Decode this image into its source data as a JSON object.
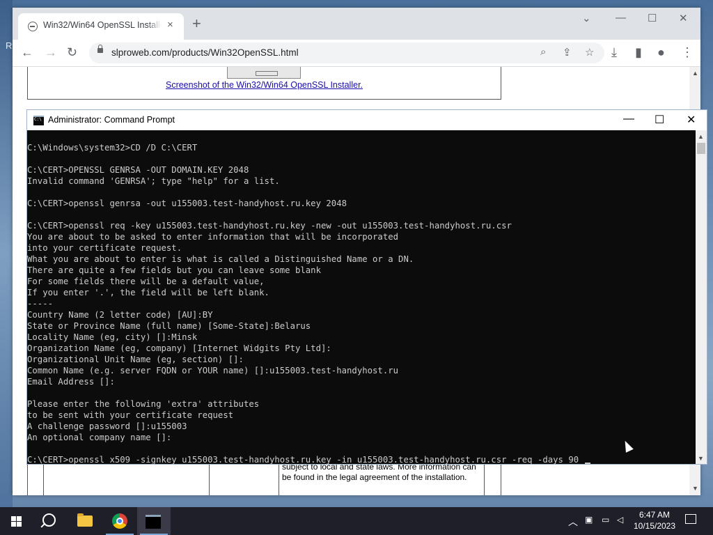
{
  "browser": {
    "tab_title": "Win32/Win64 OpenSSL Installer f",
    "tab_close": "×",
    "new_tab": "+",
    "url": "slproweb.com/products/Win32OpenSSL.html",
    "window_controls": {
      "dropdown": "⌄",
      "minimize": "—",
      "maximize": "☐",
      "close": "✕"
    },
    "nav": {
      "back": "←",
      "forward": "→",
      "reload": "↻"
    },
    "omnibox_icons": {
      "search": "⌕",
      "share": "⇪",
      "bookmark": "☆"
    },
    "toolbar_icons": {
      "download": "⤓",
      "sidepanel": "▮",
      "profile": "●",
      "menu": "⋮"
    },
    "page": {
      "screenshot_link": "Screenshot of the Win32/Win64 OpenSSL Installer.",
      "legal_text": "subject to local and state laws. More information can be found in the legal agreement of the installation."
    }
  },
  "cmd": {
    "title": "Administrator: Command Prompt",
    "controls": {
      "minimize": "—",
      "maximize": "☐",
      "close": "✕"
    },
    "lines": [
      "C:\\Windows\\system32>CD /D C:\\CERT",
      "",
      "C:\\CERT>OPENSSL GENRSA -OUT DOMAIN.KEY 2048",
      "Invalid command 'GENRSA'; type \"help\" for a list.",
      "",
      "C:\\CERT>openssl genrsa -out u155003.test-handyhost.ru.key 2048",
      "",
      "C:\\CERT>openssl req -key u155003.test-handyhost.ru.key -new -out u155003.test-handyhost.ru.csr",
      "You are about to be asked to enter information that will be incorporated",
      "into your certificate request.",
      "What you are about to enter is what is called a Distinguished Name or a DN.",
      "There are quite a few fields but you can leave some blank",
      "For some fields there will be a default value,",
      "If you enter '.', the field will be left blank.",
      "-----",
      "Country Name (2 letter code) [AU]:BY",
      "State or Province Name (full name) [Some-State]:Belarus",
      "Locality Name (eg, city) []:Minsk",
      "Organization Name (eg, company) [Internet Widgits Pty Ltd]:",
      "Organizational Unit Name (eg, section) []:",
      "Common Name (e.g. server FQDN or YOUR name) []:u155003.test-handyhost.ru",
      "Email Address []:",
      "",
      "Please enter the following 'extra' attributes",
      "to be sent with your certificate request",
      "A challenge password []:u155003",
      "An optional company name []:",
      "",
      "C:\\CERT>openssl x509 -signkey u155003.test-handyhost.ru.key -in u155003.test-handyhost.ru.csr -req -days 90"
    ]
  },
  "taskbar": {
    "time": "6:47 AM",
    "date": "10/15/2023",
    "tray_icons": {
      "chevron": "︿",
      "network": "▭",
      "volume": "🔈"
    }
  },
  "desktop": {
    "edge_letter": "R"
  }
}
